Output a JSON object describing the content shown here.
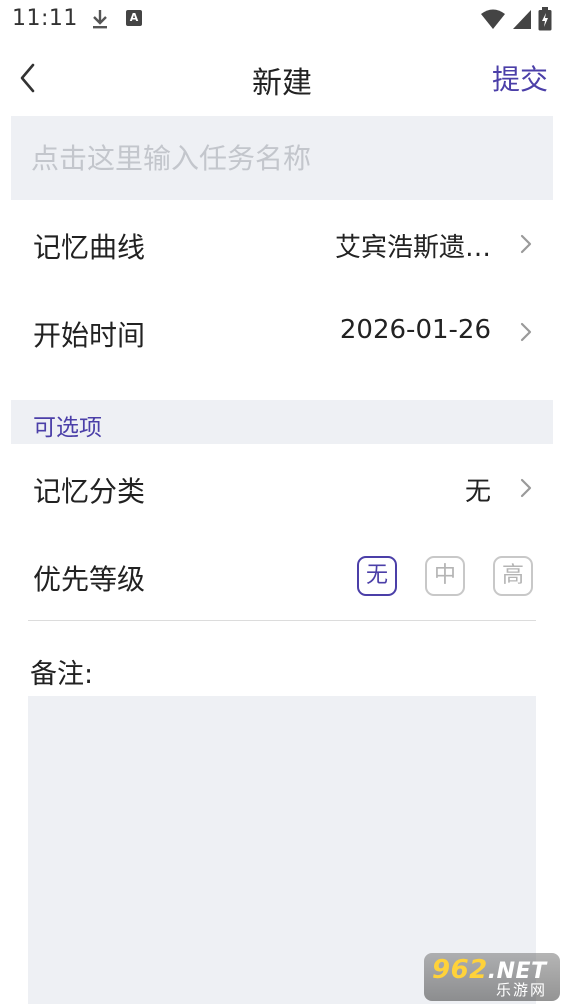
{
  "status_bar": {
    "time": "11:11",
    "icons": [
      "download-icon",
      "font-a-icon",
      "wifi-icon",
      "signal-icon",
      "battery-icon"
    ],
    "a_glyph": "A"
  },
  "header": {
    "back_icon": "chevron-left-icon",
    "title": "新建",
    "submit_label": "提交"
  },
  "task_name": {
    "value": "",
    "placeholder": "点击这里输入任务名称"
  },
  "memory_curve": {
    "label": "记忆曲线",
    "value": "艾宾浩斯遗…"
  },
  "start_time": {
    "label": "开始时间",
    "value": "2026-01-26"
  },
  "optional_section": {
    "title": "可选项"
  },
  "memory_category": {
    "label": "记忆分类",
    "value": "无"
  },
  "priority": {
    "label": "优先等级",
    "options": [
      "无",
      "中",
      "高"
    ],
    "selected": "无"
  },
  "notes": {
    "label": "备注:",
    "value": ""
  },
  "watermark": {
    "top_digits": "962",
    "top_suffix": ".NET",
    "bottom_text": "乐游网"
  },
  "colors": {
    "accent": "#4b3fa8",
    "field_bg": "#eef0f4",
    "chevron": "#9a9a9a"
  }
}
